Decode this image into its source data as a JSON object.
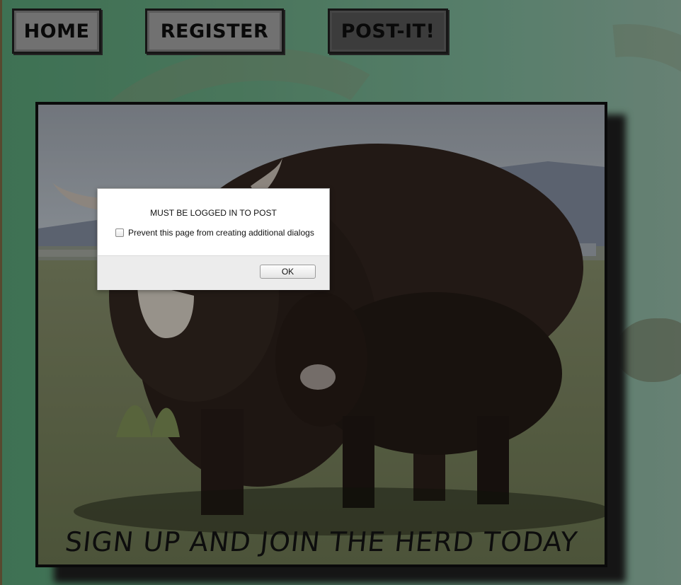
{
  "nav": {
    "home_label": "HOME",
    "register_label": "REGISTER",
    "post_label": "POST-IT!"
  },
  "hero": {
    "tagline": "SIGN UP AND JOIN THE HERD TODAY"
  },
  "dialog": {
    "message": "MUST BE LOGGED IN TO POST",
    "checkbox_label": "Prevent this page from creating additional dialogs",
    "checkbox_checked": false,
    "ok_label": "OK"
  },
  "colors": {
    "page_background": "#5f8f73",
    "nav_button": "#8a8a8a",
    "nav_button_active": "#4a4a4a",
    "border": "#0d0d0d"
  }
}
